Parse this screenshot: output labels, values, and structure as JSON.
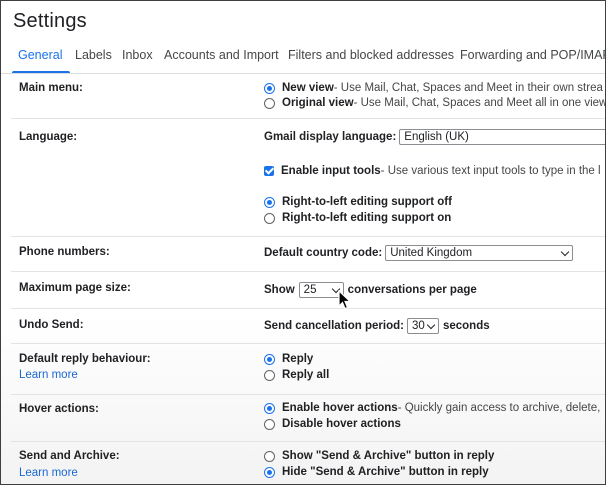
{
  "page": {
    "title": "Settings"
  },
  "tabs": [
    "General",
    "Labels",
    "Inbox",
    "Accounts and Import",
    "Filters and blocked addresses",
    "Forwarding and POP/IMAP"
  ],
  "main_menu": {
    "label": "Main menu:",
    "new_view": {
      "title": "New view",
      "desc": " - Use Mail, Chat, Spaces and Meet in their own strea"
    },
    "original_view": {
      "title": "Original view",
      "desc": " - Use Mail, Chat, Spaces and Meet all in one view"
    }
  },
  "language": {
    "label": "Language:",
    "display_language_label": "Gmail display language:",
    "display_language_value": "English (UK)",
    "input_tools_title": "Enable input tools",
    "input_tools_desc": " - Use various text input tools to type in the l",
    "rtl_off": "Right-to-left editing support off",
    "rtl_on": "Right-to-left editing support on"
  },
  "phone": {
    "label": "Phone numbers:",
    "country_label": "Default country code:",
    "country_value": "United Kingdom"
  },
  "page_size": {
    "label": "Maximum page size:",
    "show": "Show",
    "value": "25",
    "suffix": "conversations per page"
  },
  "undo_send": {
    "label": "Undo Send:",
    "period_label": "Send cancellation period:",
    "value": "30",
    "suffix": "seconds"
  },
  "reply": {
    "label": "Default reply behaviour:",
    "learn_more": "Learn more",
    "reply": "Reply",
    "reply_all": "Reply all"
  },
  "hover": {
    "label": "Hover actions:",
    "enable_title": "Enable hover actions",
    "enable_desc": " - Quickly gain access to archive, delete,",
    "disable": "Disable hover actions"
  },
  "send_archive": {
    "label": "Send and Archive:",
    "learn_more": "Learn more",
    "show": "Show \"Send & Archive\" button in reply",
    "hide": "Hide \"Send & Archive\" button in reply"
  },
  "colors": {
    "accent": "#1a73e8",
    "link": "#1a67d2"
  }
}
